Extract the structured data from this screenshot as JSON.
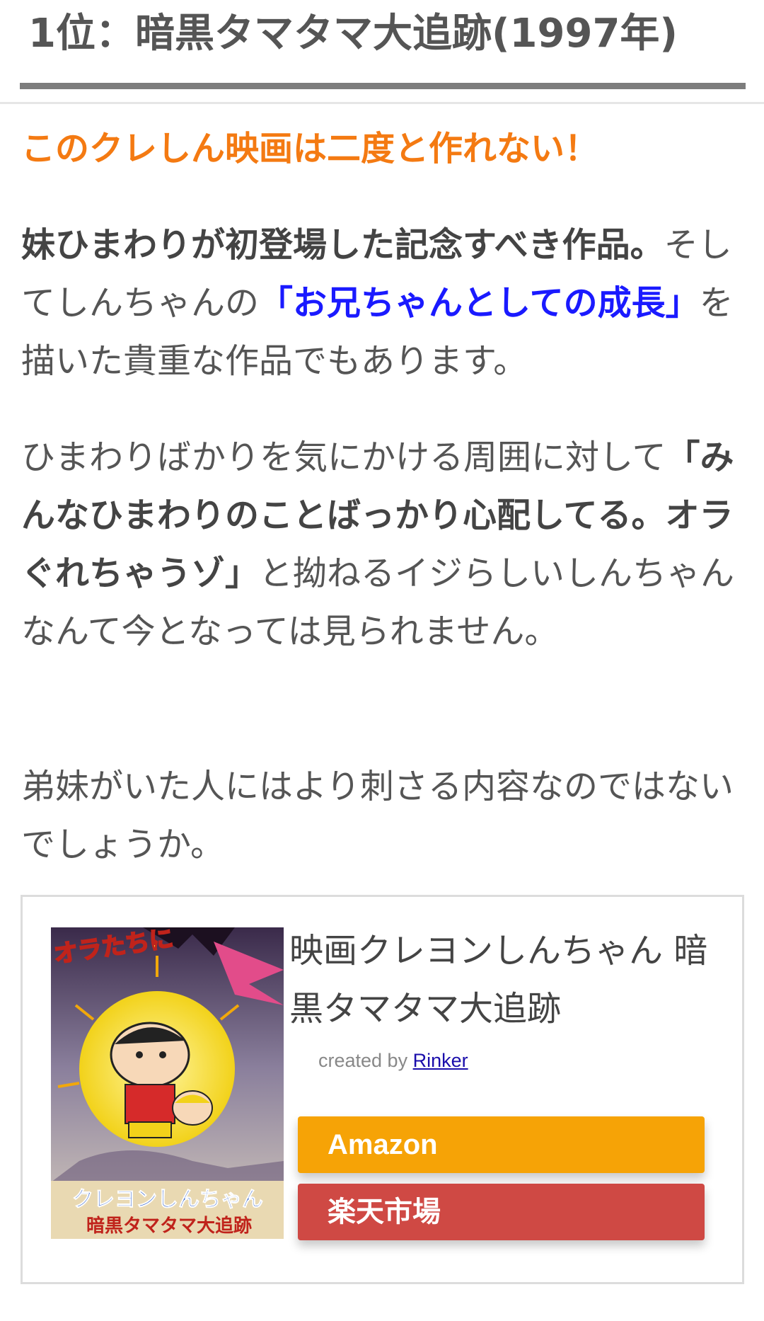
{
  "heading": "1位：暗黒タマタマ大追跡(1997年)",
  "catch": "このクレしん映画は二度と作れない！",
  "paragraph1": {
    "bold": "妹ひまわりが初登場した記念すべき作品。",
    "text1": "そしてしんちゃんの",
    "blue": "「お兄ちゃんとしての成長」",
    "text2": "を描いた貴重な作品でもあります。"
  },
  "paragraph2": {
    "text1": "ひまわりばかりを気にかける周囲に対して",
    "bold": "「みんなひまわりのことばっかり心配してる。オラぐれちゃうゾ」",
    "text2": "と拗ねるイジらしいしんちゃんなんて今となっては見られません。"
  },
  "paragraph3": "弟妹がいた人にはより刺さる内容なのではないでしょうか。",
  "product": {
    "title": "映画クレヨンしんちゃん 暗黒タマタマ大追跡",
    "credit_prefix": "created by",
    "credit_link": "Rinker",
    "poster_text_top": "オラたちに",
    "poster_text_bottom": "クレヨンしんちゃん",
    "poster_text_sub": "暗黒タマタマ大追跡",
    "buttons": {
      "amazon": "Amazon",
      "rakuten": "楽天市場"
    }
  },
  "colors": {
    "catch": "#f47a12",
    "link_blue": "#1a1aff",
    "amazon": "#f6a306",
    "rakuten": "#cf4944"
  }
}
